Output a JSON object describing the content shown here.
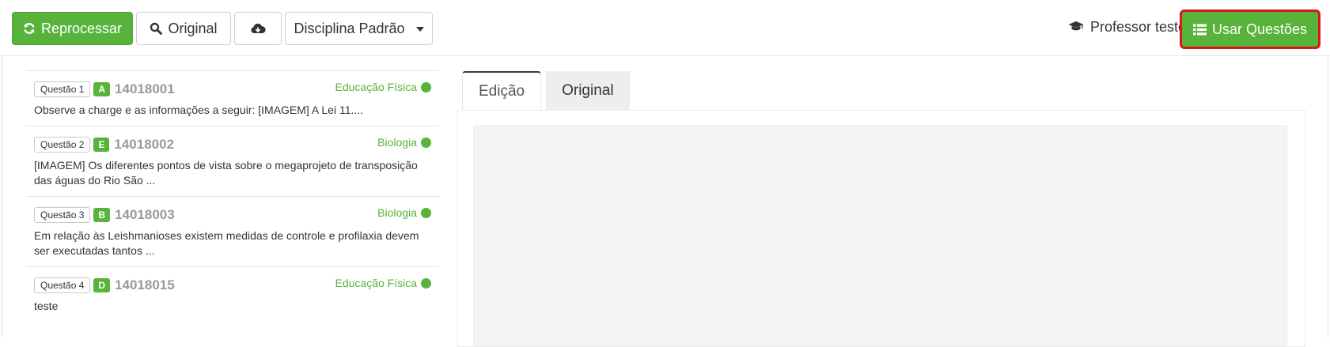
{
  "toolbar": {
    "reprocess_label": "Reprocessar",
    "original_label": "Original",
    "discipline_label": "Disciplina Padrão",
    "user_name": "Professor teste",
    "use_questions_label": "Usar Questões"
  },
  "questions": [
    {
      "label": "Questão 1",
      "letter": "A",
      "code": "14018001",
      "subject": "Educação Física",
      "text": "Observe a charge e as informações a seguir: [IMAGEM] A Lei 11...."
    },
    {
      "label": "Questão 2",
      "letter": "E",
      "code": "14018002",
      "subject": "Biologia",
      "text": "[IMAGEM] Os diferentes pontos de vista sobre o megaprojeto de transposição das águas do Rio São ..."
    },
    {
      "label": "Questão 3",
      "letter": "B",
      "code": "14018003",
      "subject": "Biologia",
      "text": "Em relação às Leishmanioses existem medidas de controle e profilaxia devem ser executadas tantos ..."
    },
    {
      "label": "Questão 4",
      "letter": "D",
      "code": "14018015",
      "subject": "Educação Física",
      "text": "teste"
    }
  ],
  "tabs": [
    {
      "label": "Edição",
      "active": true
    },
    {
      "label": "Original",
      "active": false
    }
  ],
  "icons": {
    "reprocess": "refresh-icon",
    "original": "search-icon",
    "download": "cloud-download-icon",
    "discipline": "caret-down-icon",
    "user": "graduation-cap-icon",
    "use_questions": "list-icon",
    "status": "status-dot-icon"
  },
  "colors": {
    "primary_green": "#57b33a",
    "highlight_red": "#e0141b",
    "code_gray": "#9a9a9a"
  }
}
